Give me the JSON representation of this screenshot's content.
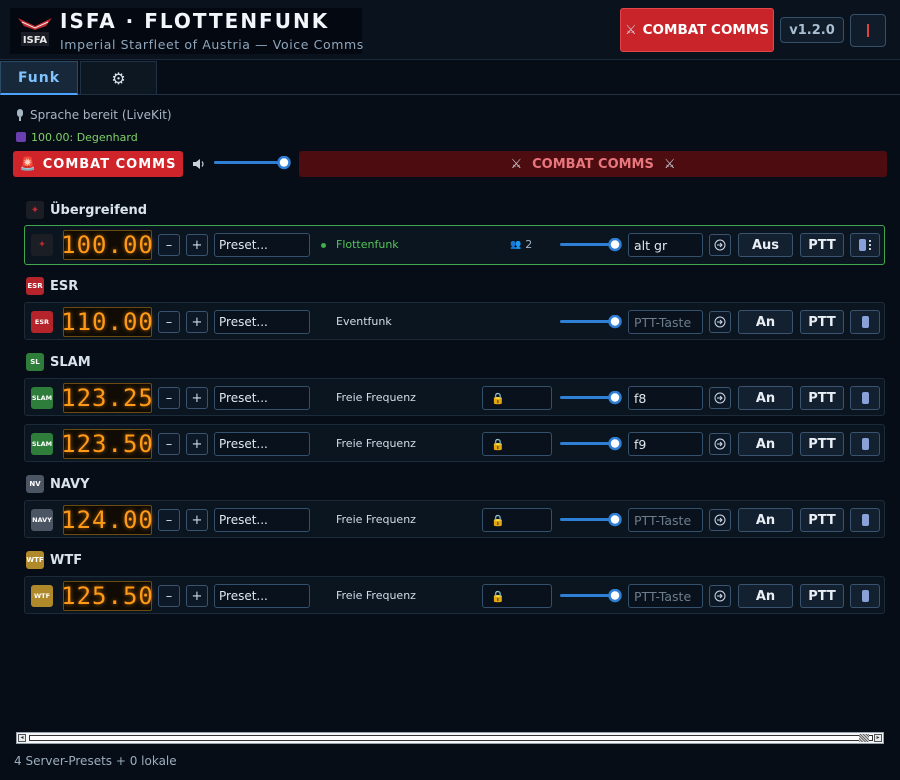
{
  "header": {
    "title": "ISFA · FLOTTENFUNK",
    "subtitle": "Imperial Starfleet of Austria — Voice Comms",
    "combat_button": "COMBAT COMMS",
    "version": "v1.2.0"
  },
  "tabs": [
    {
      "label": "Funk",
      "active": true
    },
    {
      "label": "",
      "icon": "gear-icon"
    }
  ],
  "status": {
    "text": "Sprache bereit (LiveKit)",
    "user": "100.00: Degenhard"
  },
  "global_controls": {
    "combat_label": "COMBAT COMMS",
    "master_volume": 1.0,
    "combat_banner": "COMBAT COMMS"
  },
  "groups": [
    {
      "name": "Übergreifend",
      "color": "#b5242a",
      "rows": [
        {
          "freq": "100.00",
          "preset": "Preset...",
          "channel": "Flottenfunk",
          "users": "2",
          "key": "alt gr",
          "toggle": "Aus",
          "ptt": "PTT",
          "active": true
        }
      ]
    },
    {
      "name": "ESR",
      "color": "#b5242a",
      "rows": [
        {
          "freq": "110.00",
          "preset": "Preset...",
          "channel": "Eventfunk",
          "key_placeholder": "PTT-Taste",
          "toggle": "An",
          "ptt": "PTT"
        }
      ]
    },
    {
      "name": "SLAM",
      "color": "#2f7d3a",
      "rows": [
        {
          "freq": "123.25",
          "preset": "Preset...",
          "channel": "Freie Frequenz",
          "key": "f8",
          "toggle": "An",
          "ptt": "PTT"
        },
        {
          "freq": "123.50",
          "preset": "Preset...",
          "channel": "Freie Frequenz",
          "key": "f9",
          "toggle": "An",
          "ptt": "PTT"
        }
      ]
    },
    {
      "name": "NAVY",
      "color": "#4b5563",
      "rows": [
        {
          "freq": "124.00",
          "preset": "Preset...",
          "channel": "Freie Frequenz",
          "key_placeholder": "PTT-Taste",
          "toggle": "An",
          "ptt": "PTT"
        }
      ]
    },
    {
      "name": "WTF",
      "color": "#b08a2a",
      "rows": [
        {
          "freq": "125.50",
          "preset": "Preset...",
          "channel": "Freie Frequenz",
          "key_placeholder": "PTT-Taste",
          "toggle": "An",
          "ptt": "PTT"
        }
      ]
    }
  ],
  "footer": {
    "text": "4 Server-Presets + 0 lokale"
  }
}
